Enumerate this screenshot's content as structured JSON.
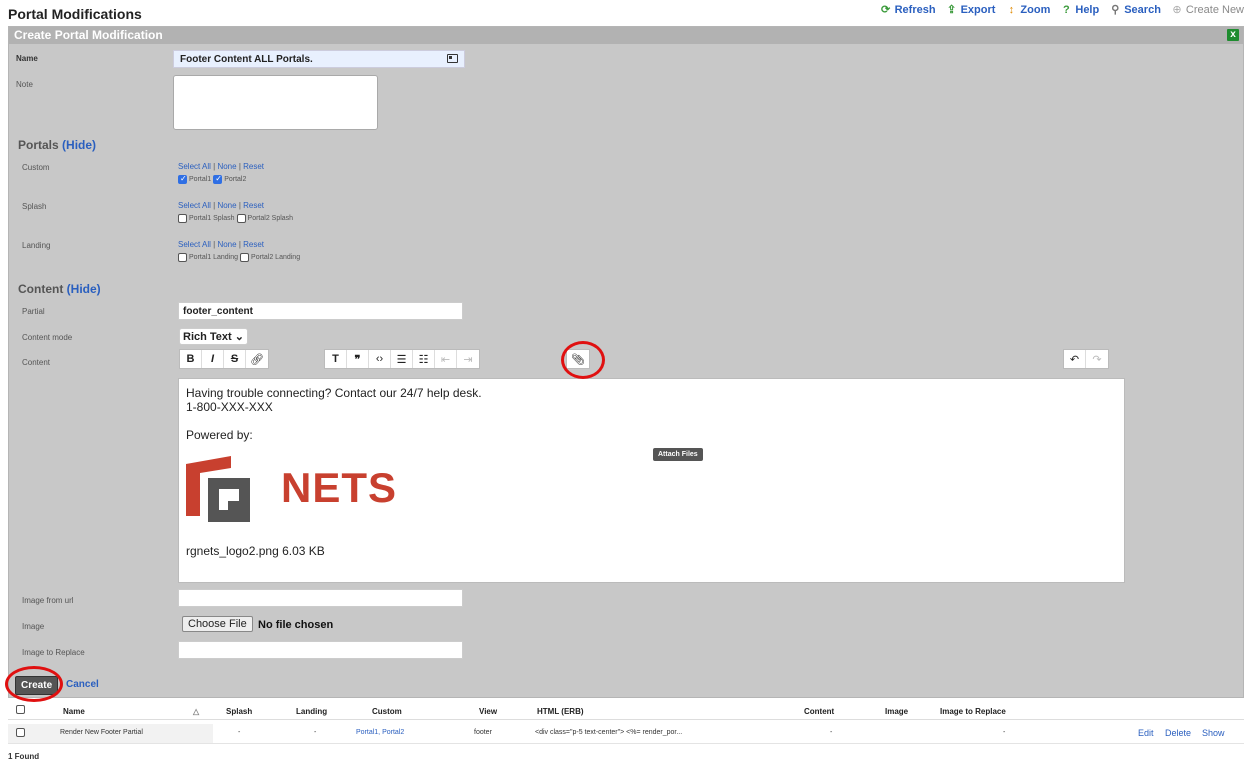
{
  "page": {
    "title": "Portal Modifications"
  },
  "toolbar": {
    "refresh": "Refresh",
    "export": "Export",
    "zoom": "Zoom",
    "help": "Help",
    "search": "Search",
    "create_new": "Create New"
  },
  "form": {
    "title": "Create Portal Modification",
    "name_label": "Name",
    "name_value": "Footer Content ALL Portals.",
    "note_label": "Note",
    "portals_heading": "Portals",
    "hide_label": "(Hide)",
    "custom_label": "Custom",
    "splash_label": "Splash",
    "landing_label": "Landing",
    "select_all": "Select All",
    "none": "None",
    "reset": "Reset",
    "sep": "|",
    "custom_opts": [
      {
        "label": "Portal1",
        "checked": true
      },
      {
        "label": "Portal2",
        "checked": true
      }
    ],
    "splash_opts": [
      {
        "label": "Portal1 Splash",
        "checked": false
      },
      {
        "label": "Portal2 Splash",
        "checked": false
      }
    ],
    "landing_opts": [
      {
        "label": "Portal1 Landing",
        "checked": false
      },
      {
        "label": "Portal2 Landing",
        "checked": false
      }
    ],
    "content_heading": "Content",
    "partial_label": "Partial",
    "partial_value": "footer_content",
    "content_mode_label": "Content mode",
    "content_mode_value": "Rich Text",
    "content_label": "Content",
    "editor_lines": [
      "Having trouble connecting?  Contact our 24/7 help desk.",
      "1-800-XXX-XXX",
      "",
      "Powered by:"
    ],
    "logo_text": "NETS",
    "attachment_caption": "rgnets_logo2.png 6.03 KB",
    "tooltip": "Attach Files",
    "image_url_label": "Image from url",
    "image_label": "Image",
    "choose_file": "Choose File",
    "no_file": "No file chosen",
    "image_replace_label": "Image to Replace",
    "create": "Create",
    "cancel": "Cancel"
  },
  "table": {
    "headers": [
      "Name",
      "Splash",
      "Landing",
      "Custom",
      "View",
      "HTML (ERB)",
      "Content",
      "Image",
      "Image to Replace"
    ],
    "sort_indicator": "△",
    "row": {
      "name": "Render New Footer Partial",
      "splash": "-",
      "landing": "-",
      "custom": "Portal1, Portal2",
      "view": "footer",
      "html": "<div class=\"p-5 text-center\"> <%= render_por...",
      "content": "-",
      "image_to_replace": "-",
      "edit": "Edit",
      "delete": "Delete",
      "show": "Show"
    },
    "found": "1 Found"
  },
  "colors": {
    "accent": "#2a5fbf",
    "highlight_circle": "#e01010",
    "logo_red": "#c8402f",
    "logo_gray": "#555555"
  }
}
